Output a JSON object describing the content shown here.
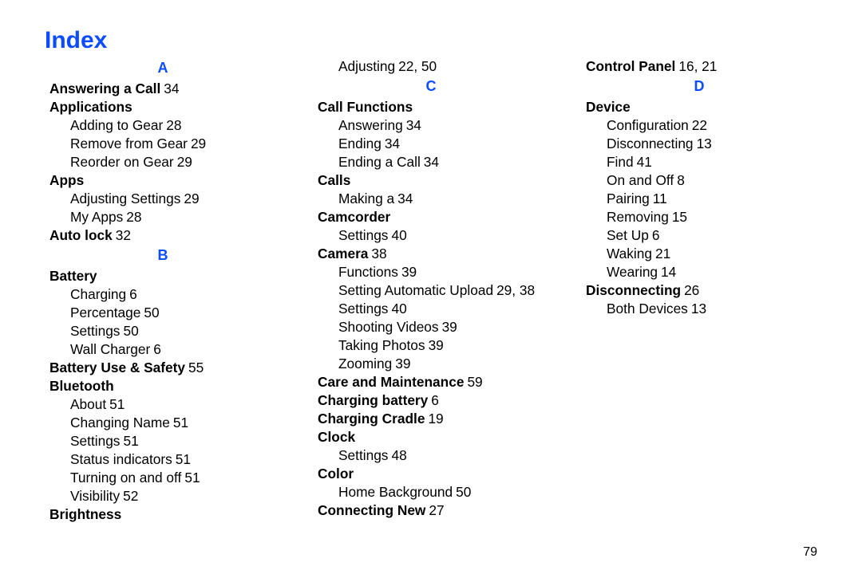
{
  "title": "Index",
  "page_number": "79",
  "letters": {
    "A": "A",
    "B": "B",
    "C": "C",
    "D": "D"
  },
  "col1": {
    "answering_call": {
      "label": "Answering a Call",
      "pages": "34"
    },
    "applications": {
      "label": "Applications",
      "sub": [
        {
          "label": "Adding to Gear",
          "pages": "28"
        },
        {
          "label": "Remove from Gear",
          "pages": "29"
        },
        {
          "label": "Reorder on Gear",
          "pages": "29"
        }
      ]
    },
    "apps": {
      "label": "Apps",
      "sub": [
        {
          "label": "Adjusting Settings",
          "pages": "29"
        },
        {
          "label": "My Apps",
          "pages": "28"
        }
      ]
    },
    "auto_lock": {
      "label": "Auto lock",
      "pages": "32"
    },
    "battery": {
      "label": "Battery",
      "sub": [
        {
          "label": "Charging",
          "pages": "6"
        },
        {
          "label": "Percentage",
          "pages": "50"
        },
        {
          "label": "Settings",
          "pages": "50"
        },
        {
          "label": "Wall Charger",
          "pages": "6"
        }
      ]
    },
    "battery_safety": {
      "label": "Battery Use & Safety",
      "pages": "55"
    },
    "bluetooth": {
      "label": "Bluetooth",
      "sub": [
        {
          "label": "About",
          "pages": "51"
        },
        {
          "label": "Changing Name",
          "pages": "51"
        },
        {
          "label": "Settings",
          "pages": "51"
        },
        {
          "label": "Status indicators",
          "pages": "51"
        }
      ]
    }
  },
  "col2": {
    "bluetooth_cont": [
      {
        "label": "Turning on and off",
        "pages": "51"
      },
      {
        "label": "Visibility",
        "pages": "52"
      }
    ],
    "brightness": {
      "label": "Brightness",
      "sub": [
        {
          "label": "Adjusting",
          "pages": "22, 50"
        }
      ]
    },
    "call_functions": {
      "label": "Call Functions",
      "sub": [
        {
          "label": "Answering",
          "pages": "34"
        },
        {
          "label": "Ending",
          "pages": "34"
        },
        {
          "label": "Ending a Call",
          "pages": "34"
        }
      ]
    },
    "calls": {
      "label": "Calls",
      "sub": [
        {
          "label": "Making a",
          "pages": "34"
        }
      ]
    },
    "camcorder": {
      "label": "Camcorder",
      "sub": [
        {
          "label": "Settings",
          "pages": "40"
        }
      ]
    },
    "camera": {
      "label": "Camera",
      "pages": "38",
      "sub": [
        {
          "label": "Functions",
          "pages": "39"
        },
        {
          "label": "Setting Automatic Upload",
          "pages": "29, 38"
        },
        {
          "label": "Settings",
          "pages": "40"
        },
        {
          "label": "Shooting Videos",
          "pages": "39"
        },
        {
          "label": "Taking Photos",
          "pages": "39"
        },
        {
          "label": "Zooming",
          "pages": "39"
        }
      ]
    }
  },
  "col3": {
    "care": {
      "label": "Care and Maintenance",
      "pages": "59"
    },
    "charging_battery": {
      "label": "Charging battery",
      "pages": "6"
    },
    "charging_cradle": {
      "label": "Charging Cradle",
      "pages": "19"
    },
    "clock": {
      "label": "Clock",
      "sub": [
        {
          "label": "Settings",
          "pages": "48"
        }
      ]
    },
    "color": {
      "label": "Color",
      "sub": [
        {
          "label": "Home Background",
          "pages": "50"
        }
      ]
    },
    "connecting_new": {
      "label": "Connecting New",
      "pages": "27"
    },
    "control_panel": {
      "label": "Control Panel",
      "pages": "16, 21"
    },
    "device": {
      "label": "Device",
      "sub": [
        {
          "label": "Configuration",
          "pages": "22"
        },
        {
          "label": "Disconnecting",
          "pages": "13"
        },
        {
          "label": "Find",
          "pages": "41"
        },
        {
          "label": "On and Off",
          "pages": "8"
        },
        {
          "label": "Pairing",
          "pages": "11"
        },
        {
          "label": "Removing",
          "pages": "15"
        },
        {
          "label": "Set Up",
          "pages": "6"
        },
        {
          "label": "Waking",
          "pages": "21"
        },
        {
          "label": "Wearing",
          "pages": "14"
        }
      ]
    },
    "disconnecting": {
      "label": "Disconnecting",
      "pages": "26",
      "sub": [
        {
          "label": "Both Devices",
          "pages": "13"
        }
      ]
    }
  }
}
